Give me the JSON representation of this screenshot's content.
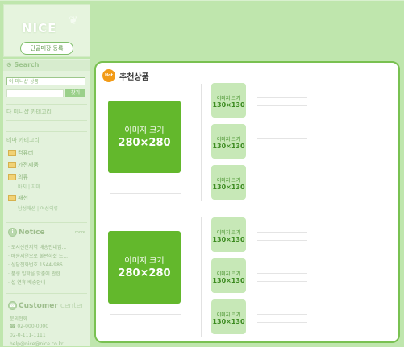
{
  "header": {
    "logo": "NICE",
    "register_button": "단골매장 등록"
  },
  "sidebar": {
    "search": {
      "title": "Search",
      "select_value": "이 미니샵 상품",
      "button": "찾기"
    },
    "other_category": "다 미니샵 카테고리",
    "category_title": "테마 카테고리",
    "categories": [
      {
        "label": "컴퓨터"
      },
      {
        "label": "가전제품"
      },
      {
        "label": "의류",
        "sub": "바지 | 치마"
      },
      {
        "label": "패션",
        "sub": "남성패션 | 여성의류"
      }
    ],
    "notice": {
      "title": "Notice",
      "more": "more",
      "items": [
        "· 도서산간지역 배송안내입...",
        "· 배송지연으로 불편하셨 드...",
        "· 상담전화번호 1544-986...",
        "· 품생 입학을 맞춤에 관한...",
        "· 설 연휴 배송안내"
      ]
    },
    "customer": {
      "title": "Customer",
      "subtitle": "center",
      "items": [
        "문의전화",
        "☎ 02-000-0000",
        "02-0-111-1111",
        "help@nice@nice.co.kr"
      ]
    }
  },
  "main": {
    "title": "추천상품",
    "hot": "Hot",
    "big_image": {
      "label1": "이미지 크기",
      "label2": "280×280"
    },
    "small_image": {
      "label1": "이미지 크기",
      "label2": "130×130"
    }
  }
}
